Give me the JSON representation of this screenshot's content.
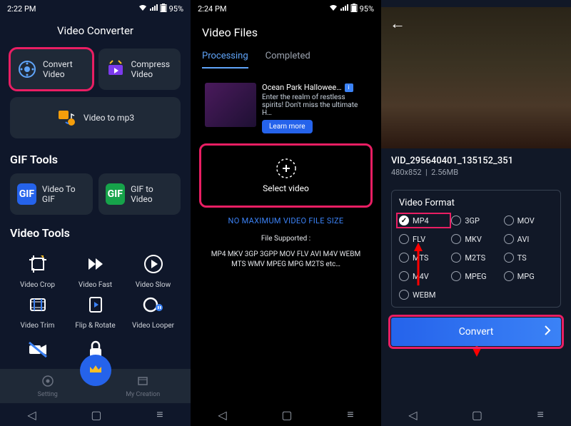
{
  "statusbar1": {
    "time": "2:22 PM",
    "battery": "95%"
  },
  "statusbar2": {
    "time": "2:24 PM",
    "battery": "95%"
  },
  "statusbar3": {
    "battery": ""
  },
  "screen1": {
    "title": "Video Converter",
    "convert_video": "Convert Video",
    "compress_video": "Compress Video",
    "video_to_mp3": "Video to mp3",
    "gif_tools_h": "GIF Tools",
    "video_to_gif": "Video To GIF",
    "gif_to_video": "GIF to Video",
    "video_tools_h": "Video Tools",
    "tools": {
      "crop": "Video Crop",
      "fast": "Video Fast",
      "slow": "Video Slow",
      "trim": "Video Trim",
      "flip": "Flip & Rotate",
      "looper": "Video Looper"
    },
    "nav": {
      "setting": "Setting",
      "creation": "My Creation"
    }
  },
  "screen2": {
    "title": "Video Files",
    "tabs": {
      "processing": "Processing",
      "completed": "Completed"
    },
    "ad": {
      "title": "Ocean Park Hallowee…",
      "line1": "Enter the realm of restless",
      "line2": "spirits! Don't miss the ultimate H…",
      "learn_more": "Learn more"
    },
    "select_video": "Select video",
    "no_max": "NO MAXIMUM VIDEO FILE SIZE",
    "file_supported_h": "File Supported :",
    "file_supported": "MP4 MKV 3GP 3GPP MOV FLV AVI M4V WEBM MTS WMV MPEG MPG M2TS etc…"
  },
  "screen3": {
    "video_name": "VID_295640401_135152_351",
    "resolution": "480x852",
    "size": "2.56MB",
    "format_h": "Video Format",
    "formats": {
      "mp4": "MP4",
      "3gp": "3GP",
      "mov": "MOV",
      "flv": "FLV",
      "mkv": "MKV",
      "avi": "AVI",
      "mts": "MTS",
      "m2ts": "M2TS",
      "ts": "TS",
      "m4v": "M4V",
      "mpeg": "MPEG",
      "mpg": "MPG",
      "webm": "WEBM"
    },
    "convert": "Convert"
  }
}
